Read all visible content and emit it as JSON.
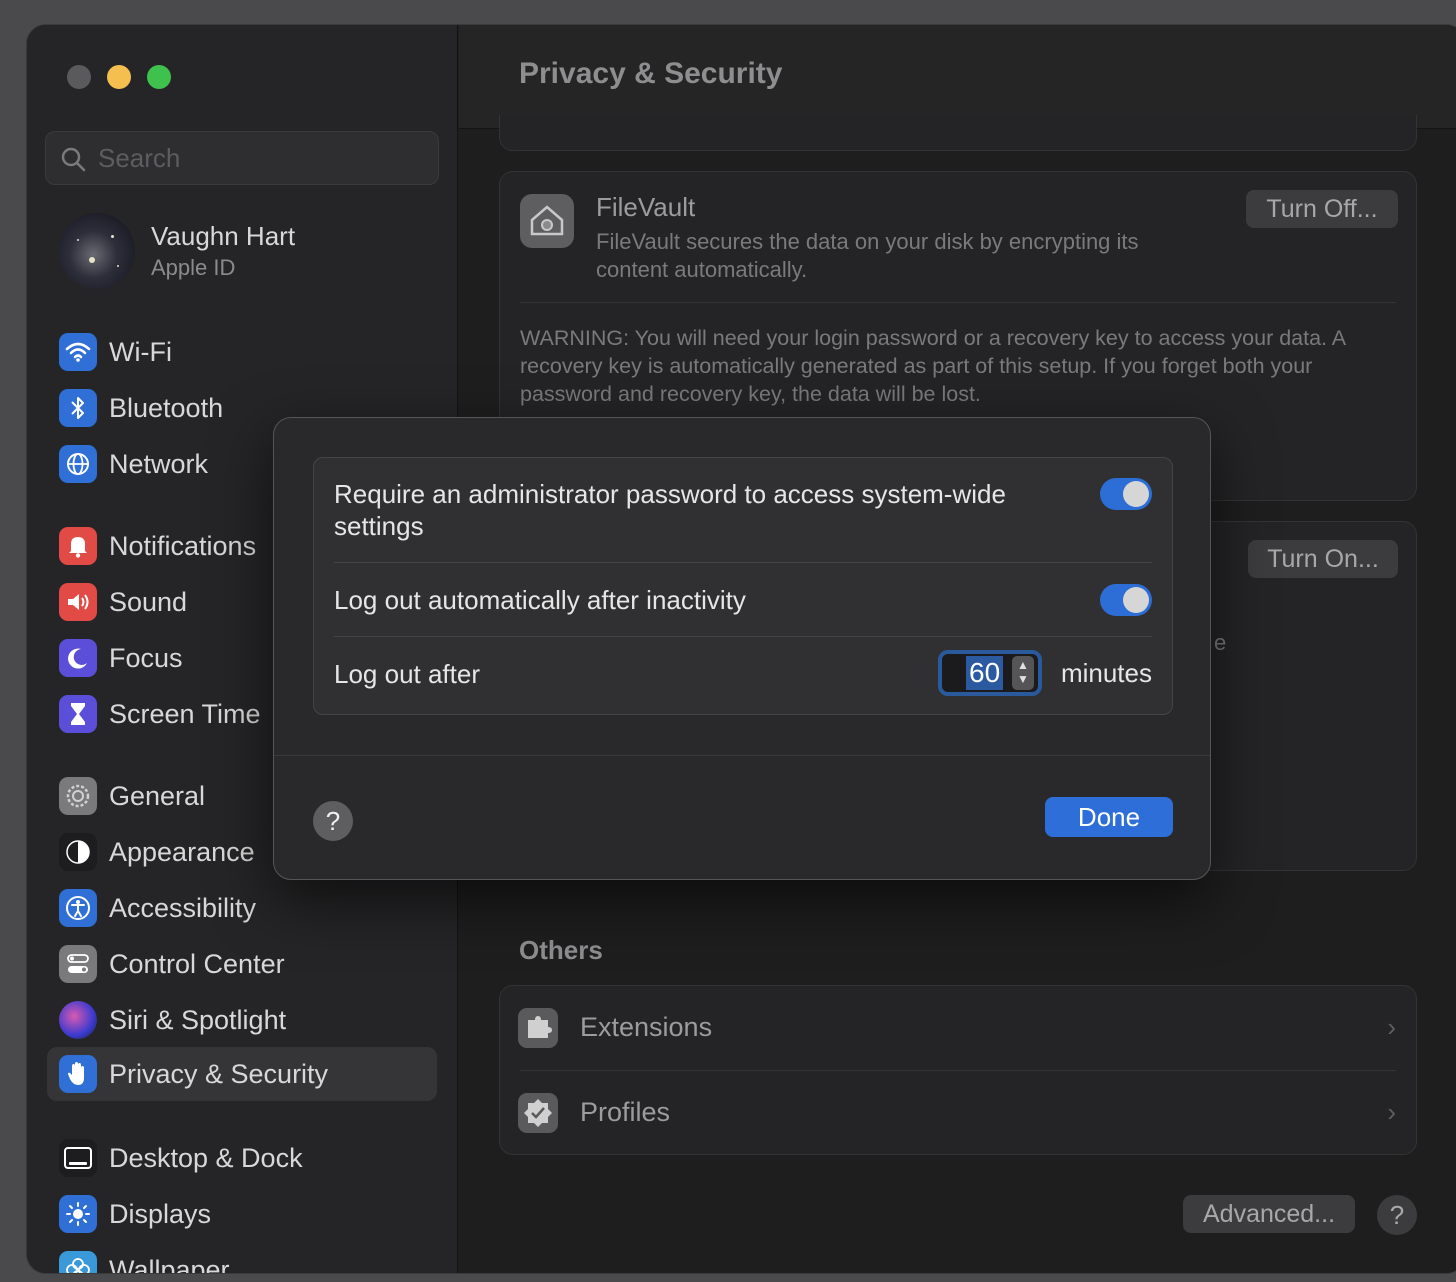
{
  "window": {
    "title": "Privacy & Security"
  },
  "search": {
    "placeholder": "Search"
  },
  "profile": {
    "name": "Vaughn Hart",
    "subtitle": "Apple ID"
  },
  "sidebar": {
    "items": [
      {
        "label": "Wi-Fi",
        "icon": "wifi-icon",
        "color": "#2f6fd6"
      },
      {
        "label": "Bluetooth",
        "icon": "bluetooth-icon",
        "color": "#2f6fd6"
      },
      {
        "label": "Network",
        "icon": "globe-icon",
        "color": "#2f6fd6"
      },
      {
        "label": "Notifications",
        "icon": "bell-icon",
        "color": "#e14a45"
      },
      {
        "label": "Sound",
        "icon": "speaker-icon",
        "color": "#e14a45"
      },
      {
        "label": "Focus",
        "icon": "moon-icon",
        "color": "#5b4ed8"
      },
      {
        "label": "Screen Time",
        "icon": "hourglass-icon",
        "color": "#5b4ed8"
      },
      {
        "label": "General",
        "icon": "gear-icon",
        "color": "#7a7a7c"
      },
      {
        "label": "Appearance",
        "icon": "appearance-icon",
        "color": "#1d1d1f"
      },
      {
        "label": "Accessibility",
        "icon": "accessibility-icon",
        "color": "#2f6fd6"
      },
      {
        "label": "Control Center",
        "icon": "control-center-icon",
        "color": "#7a7a7c"
      },
      {
        "label": "Siri & Spotlight",
        "icon": "siri-icon",
        "color": "#8e3a9e"
      },
      {
        "label": "Privacy & Security",
        "icon": "hand-icon",
        "color": "#2f6fd6"
      },
      {
        "label": "Desktop & Dock",
        "icon": "dock-icon",
        "color": "#1d1d1f"
      },
      {
        "label": "Displays",
        "icon": "sun-icon",
        "color": "#2f6fd6"
      },
      {
        "label": "Wallpaper",
        "icon": "flower-icon",
        "color": "#3a9ad9"
      }
    ]
  },
  "filevault": {
    "title": "FileVault",
    "description": "FileVault secures the data on your disk by encrypting its content automatically.",
    "button": "Turn Off...",
    "warning": "WARNING: You will need your login password or a recovery key to access your data. A recovery key is automatically generated as part of this setup. If you forget both your password and recovery key, the data will be lost."
  },
  "lockdown": {
    "button": "Turn On...",
    "partial_text": "e"
  },
  "others": {
    "title": "Others",
    "items": [
      {
        "label": "Extensions",
        "icon": "puzzle-icon"
      },
      {
        "label": "Profiles",
        "icon": "checkmark-badge-icon"
      }
    ]
  },
  "footer": {
    "advanced": "Advanced...",
    "help": "?"
  },
  "dialog": {
    "require_admin_label": "Require an administrator password to access system-wide settings",
    "require_admin_on": true,
    "auto_logout_label": "Log out automatically after inactivity",
    "auto_logout_on": true,
    "logout_after_label": "Log out after",
    "logout_after_value": "60",
    "logout_after_unit": "minutes",
    "help": "?",
    "done": "Done"
  }
}
